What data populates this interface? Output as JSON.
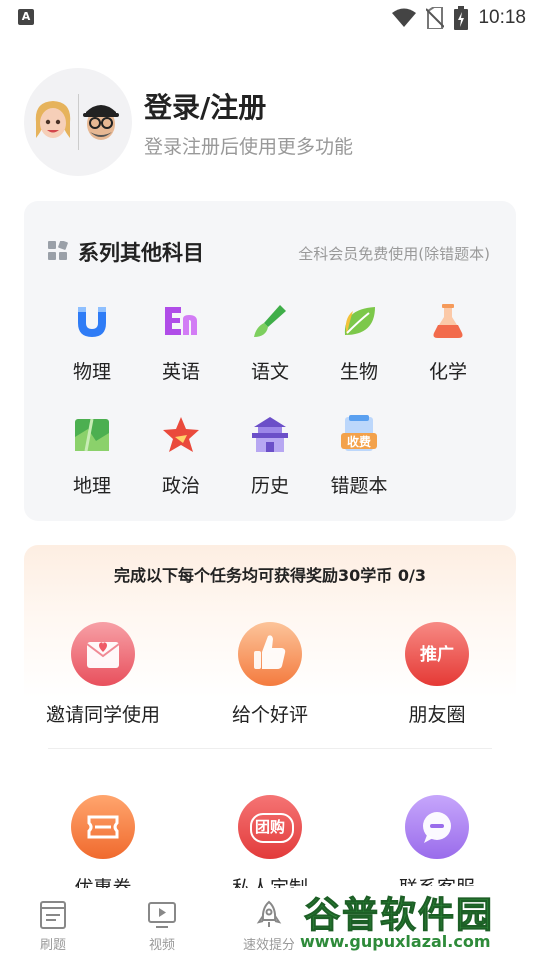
{
  "status_bar": {
    "time": "10:18",
    "notification_icon_label": "A"
  },
  "profile": {
    "title": "登录/注册",
    "subtitle": "登录注册后使用更多功能"
  },
  "subjects_section": {
    "title": "系列其他科目",
    "note": "全科会员免费使用(除错题本)",
    "items": [
      {
        "label": "物理",
        "icon": "magnet-icon",
        "color": "#2f7cf6"
      },
      {
        "label": "英语",
        "icon": "en-letters-icon",
        "color": "#b04de8"
      },
      {
        "label": "语文",
        "icon": "brush-icon",
        "color": "#3fae49"
      },
      {
        "label": "生物",
        "icon": "leaf-icon",
        "color": "#7cc84a"
      },
      {
        "label": "化学",
        "icon": "flask-icon",
        "color": "#f26b4c"
      },
      {
        "label": "地理",
        "icon": "map-icon",
        "color": "#4caf50"
      },
      {
        "label": "政治",
        "icon": "star-flag-icon",
        "color": "#ea4a3c"
      },
      {
        "label": "历史",
        "icon": "temple-icon",
        "color": "#6b4fc8"
      },
      {
        "label": "错题本",
        "icon": "notebook-icon",
        "color": "#5aa0f0",
        "badge": "收费"
      }
    ]
  },
  "tasks_section": {
    "header": "完成以下每个任务均可获得奖励30学币 0/3",
    "tasks": [
      {
        "label": "邀请同学使用",
        "icon": "envelope-heart-icon",
        "color": "#ee5a6a"
      },
      {
        "label": "给个好评",
        "icon": "thumbs-up-icon",
        "color": "#f5894a"
      },
      {
        "label": "朋友圈",
        "icon": "promote-icon",
        "color": "#ef5350",
        "badge": "推广"
      }
    ],
    "services": [
      {
        "label": "优惠券",
        "icon": "coupon-icon",
        "color": "#f47a3d"
      },
      {
        "label": "私人定制",
        "icon": "group-buy-icon",
        "color": "#e84343",
        "badge": "团购"
      },
      {
        "label": "联系客服",
        "icon": "chat-icon",
        "color": "#a87ef0"
      }
    ]
  },
  "bottom_nav": [
    {
      "label": "刷题",
      "icon": "book-icon"
    },
    {
      "label": "视频",
      "icon": "video-icon"
    },
    {
      "label": "速效提分",
      "icon": "rocket-icon"
    }
  ],
  "watermark": {
    "brand": "谷普软件园",
    "url": "www.gupuxlazal.com"
  }
}
